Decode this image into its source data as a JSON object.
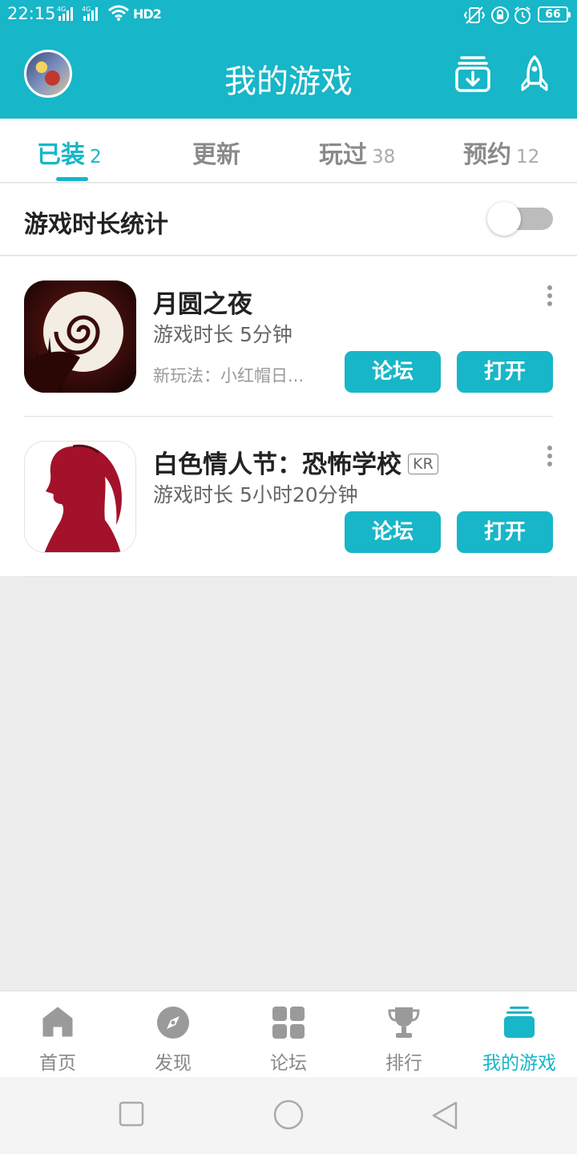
{
  "status_bar": {
    "time": "22:15",
    "hd_label": "HD2",
    "battery": "66"
  },
  "header": {
    "title": "我的游戏"
  },
  "tabs": [
    {
      "label": "已装",
      "count": "2",
      "active": true
    },
    {
      "label": "更新",
      "count": ""
    },
    {
      "label": "玩过",
      "count": "38"
    },
    {
      "label": "预约",
      "count": "12"
    }
  ],
  "playtime_stats": {
    "label": "游戏时长统计",
    "enabled": false
  },
  "games": [
    {
      "name": "月圆之夜",
      "playtime": "游戏时长 5分钟",
      "desc": "新玩法：小红帽日...",
      "forum_label": "论坛",
      "open_label": "打开"
    },
    {
      "name": "白色情人节：恐怖学校",
      "badge": "KR",
      "playtime": "游戏时长 5小时20分钟",
      "forum_label": "论坛",
      "open_label": "打开"
    }
  ],
  "bottom_nav": [
    {
      "label": "首页",
      "icon": "home-icon"
    },
    {
      "label": "发现",
      "icon": "compass-icon"
    },
    {
      "label": "论坛",
      "icon": "grid-icon"
    },
    {
      "label": "排行",
      "icon": "trophy-icon"
    },
    {
      "label": "我的游戏",
      "icon": "stack-icon",
      "active": true
    }
  ],
  "colors": {
    "accent": "#17b6c8",
    "background": "#ededed"
  }
}
